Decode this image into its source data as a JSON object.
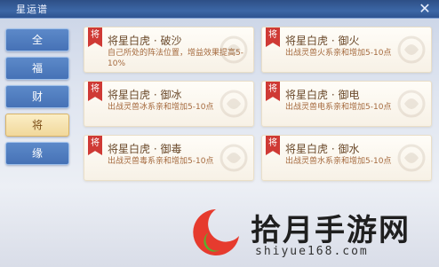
{
  "header": {
    "title": "星运谱",
    "close_icon": "close-icon"
  },
  "sidebar": {
    "tabs": [
      {
        "label": "全",
        "active": false
      },
      {
        "label": "福",
        "active": false
      },
      {
        "label": "财",
        "active": false
      },
      {
        "label": "将",
        "active": true
      },
      {
        "label": "缘",
        "active": false
      }
    ]
  },
  "cards": [
    {
      "badge": "将",
      "title": "将星白虎 · 破沙",
      "desc": "自己所处的阵法位置，增益效果提高5-10%"
    },
    {
      "badge": "将",
      "title": "将星白虎 · 御火",
      "desc": "出战灵兽火系亲和增加5-10点"
    },
    {
      "badge": "将",
      "title": "将星白虎 · 御冰",
      "desc": "出战灵兽冰系亲和增加5-10点"
    },
    {
      "badge": "将",
      "title": "将星白虎 · 御电",
      "desc": "出战灵兽电系亲和增加5-10点"
    },
    {
      "badge": "将",
      "title": "将星白虎 · 御毒",
      "desc": "出战灵兽毒系亲和增加5-10点"
    },
    {
      "badge": "将",
      "title": "将星白虎 · 御水",
      "desc": "出战灵兽水系亲和增加5-10点"
    }
  ],
  "watermark": {
    "brand": "拾月手游网",
    "url": "shiyue168.com"
  },
  "colors": {
    "header_blue": "#3c67a6",
    "badge_red": "#cf3a35",
    "active_tab_gold": "#f1d89b"
  }
}
